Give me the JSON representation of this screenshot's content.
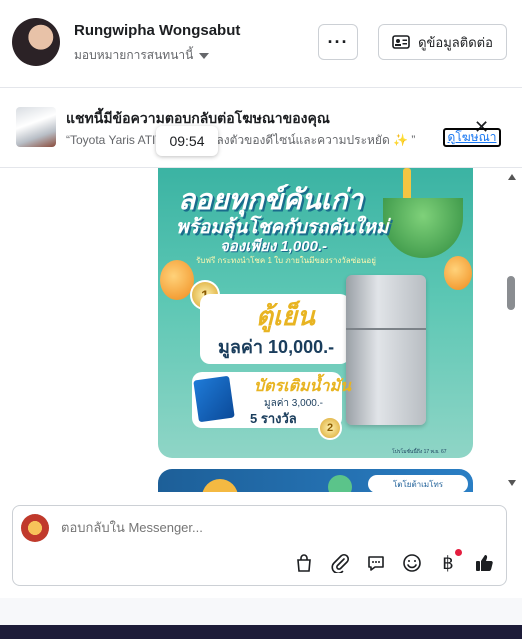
{
  "header": {
    "name": "Rungwipha Wongsabut",
    "assignment": "มอบหมายการสนทนานี้",
    "more_label": "···",
    "contact_label": "ดูข้อมูลติดต่อ"
  },
  "ad_banner": {
    "title": "แชทนี้มีข้อความตอบกลับต่อโฆษณาของคุณ",
    "preview": "“Toyota Yaris ATIV ใหม่ ...ามลงตัวของดีไซน์และความประหยัด ✨ ”",
    "link_label": "ดูโฆษณา",
    "close_label": "✕",
    "time_tooltip": "09:54"
  },
  "ad_image": {
    "headline1": "ลอยทุกข์คันเก่า",
    "headline2": "พร้อมลุ้นโชคกับรถคันใหม่",
    "headline3": "จองเพียง 1,000.-",
    "small_text": "รับฟรี กระทงนำโชค 1 ใบ ภายในมีของรางวัลซ่อนอยู่",
    "medal1": "1",
    "prize1_title": "ตู้เย็น",
    "prize1_value": "มูลค่า 10,000.-",
    "medal2": "2",
    "prize2_title": "บัตรเติมน้ำมัน",
    "prize2_value": "มูลค่า 3,000.-",
    "prize2_count": "5 รางวัล",
    "footnote": "โปรโมชั่นนี้ถึง 17 พ.ย. 67"
  },
  "ad_image2": {
    "badge": "โตโยต้าเมโทร"
  },
  "composer": {
    "placeholder": "ตอบกลับใน Messenger..."
  },
  "colors": {
    "link": "#1877f2",
    "notify_dot": "#e41e3f"
  }
}
